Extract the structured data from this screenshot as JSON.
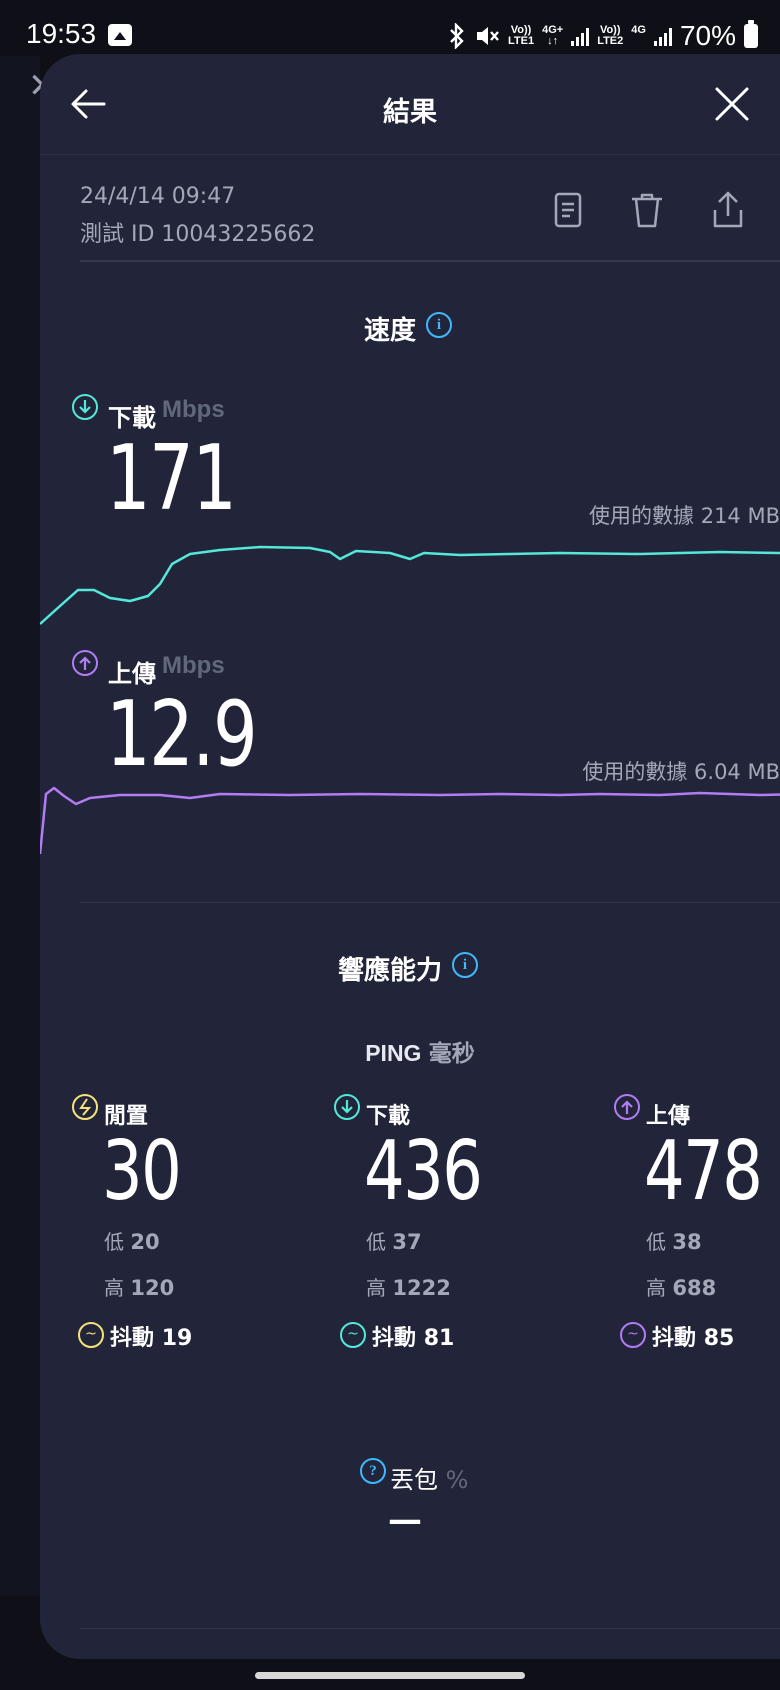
{
  "status_bar": {
    "time": "19:53",
    "battery": "70%",
    "sim1": "LTE1",
    "sim2": "LTE2",
    "net1": "4G+",
    "net2": "4G",
    "volte": "Vo))"
  },
  "header": {
    "title": "結果"
  },
  "meta": {
    "date": "24/4/14 09:47",
    "test_id": "測試 ID 10043225662"
  },
  "speed": {
    "title": "速度",
    "download": {
      "label": "下載",
      "unit": "Mbps",
      "value": "171",
      "data_used": "使用的數據 214 MB"
    },
    "upload": {
      "label": "上傳",
      "unit": "Mbps",
      "value": "12.9",
      "data_used": "使用的數據 6.04 MB"
    }
  },
  "responsiveness": {
    "title": "響應能力",
    "ping_label": "PING",
    "ping_unit": "毫秒",
    "low_label": "低",
    "high_label": "高",
    "jitter_label": "抖動",
    "columns": [
      {
        "label": "閒置",
        "value": "30",
        "low": "20",
        "high": "120",
        "jitter": "19",
        "color": "#f5e27a"
      },
      {
        "label": "下載",
        "value": "436",
        "low": "37",
        "high": "1222",
        "jitter": "81",
        "color": "#54e8d8"
      },
      {
        "label": "上傳",
        "value": "478",
        "low": "38",
        "high": "688",
        "jitter": "85",
        "color": "#b27cf2"
      }
    ]
  },
  "packet_loss": {
    "label": "丟包",
    "unit": "%",
    "value": "—"
  },
  "colors": {
    "download": "#54e8d8",
    "upload": "#b27cf2",
    "info": "#3fb8ff",
    "sheet": "#22253a"
  }
}
